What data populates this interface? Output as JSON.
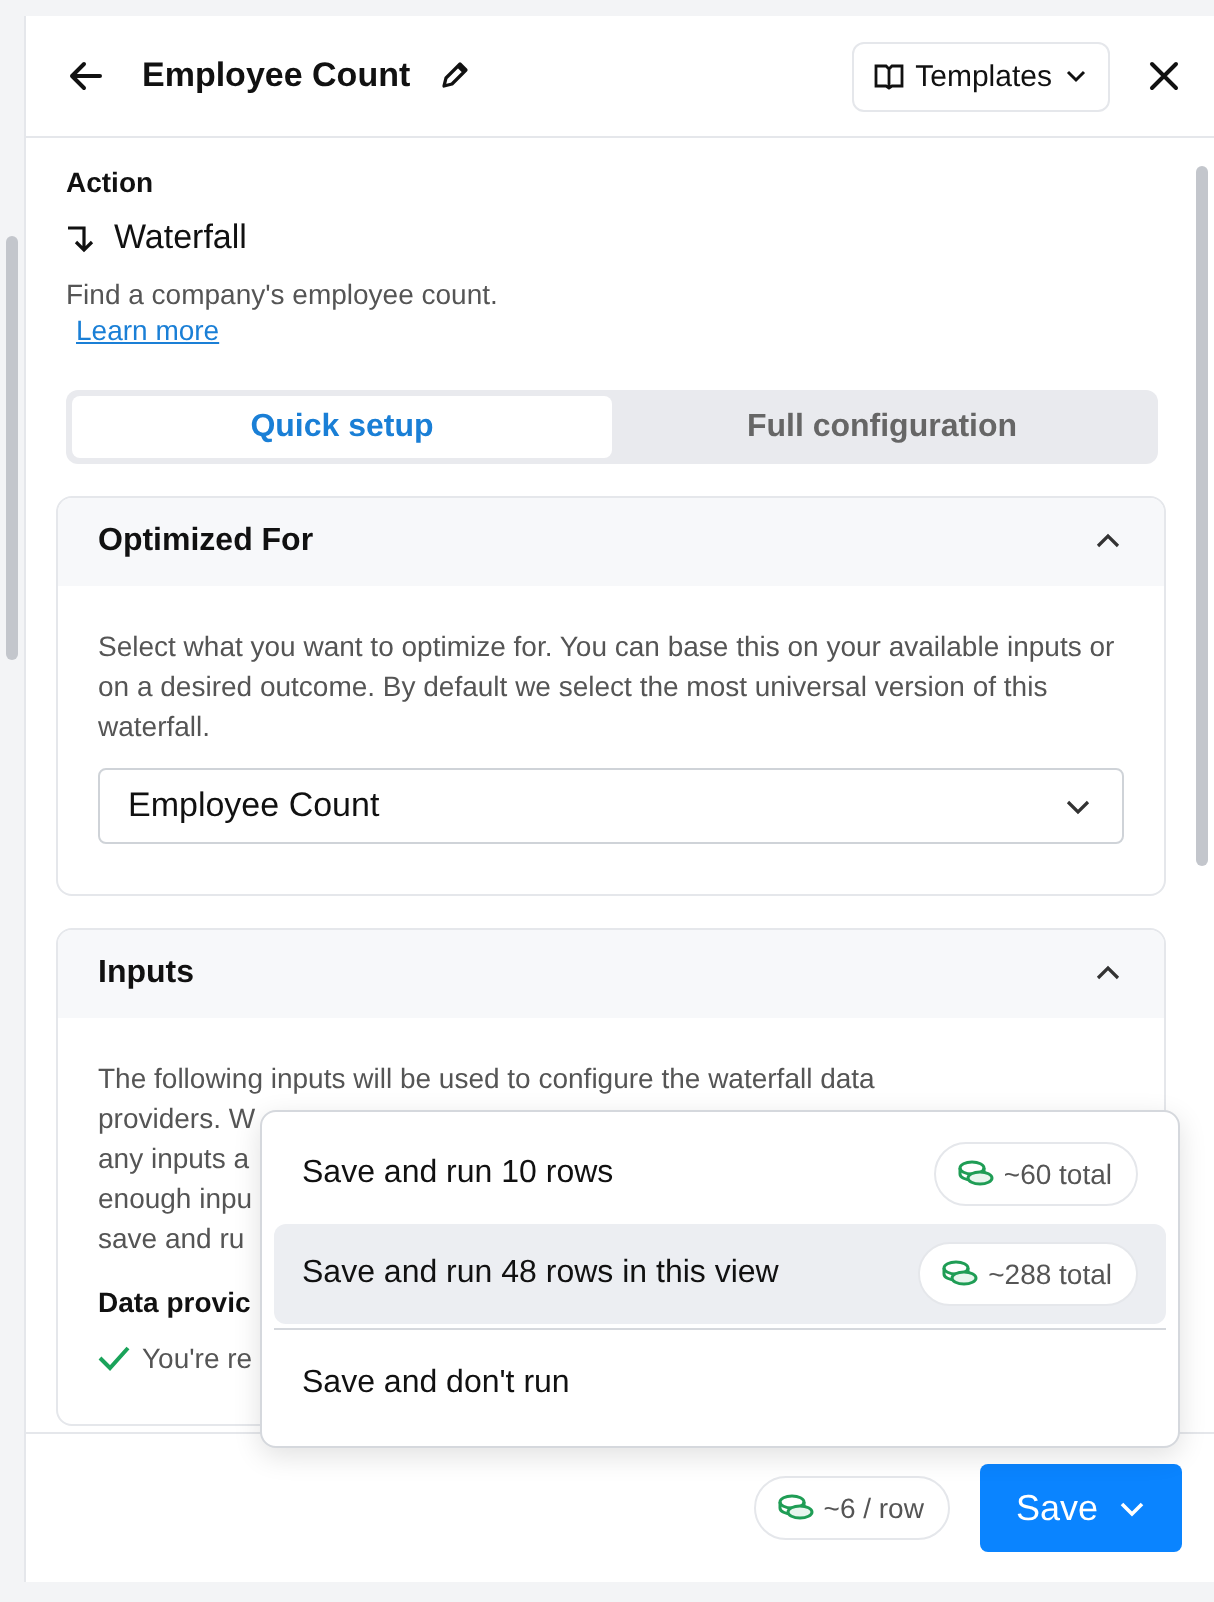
{
  "header": {
    "title": "Employee Count",
    "templates_button": "Templates"
  },
  "action": {
    "label": "Action",
    "name": "Waterfall",
    "description": "Find a company's employee count.",
    "link": "Learn more"
  },
  "tabs": [
    {
      "label": "Quick setup",
      "selected": true
    },
    {
      "label": "Full configuration",
      "selected": false
    }
  ],
  "sections": [
    {
      "title": "Optimized For",
      "expanded": true,
      "description": "Select what you want to optimize for. You can base this on your available inputs or on a desired outcome. By default we select the most universal version of this waterfall.",
      "select_value": "Employee Count"
    },
    {
      "title": "Inputs",
      "expanded": true,
      "lines": [
        "The following inputs will be used to configure the waterfall data",
        "providers. W",
        "any inputs a",
        "enough inpu",
        "save and ru"
      ],
      "subheading": "Data provic",
      "check_text": "You're re"
    }
  ],
  "menu": [
    {
      "label": "Save and run 10 rows",
      "cost": "~60 total",
      "selected": false
    },
    {
      "label": "Save and run 48 rows in this view",
      "cost": "~288 total",
      "selected": true
    },
    {
      "label": "Save and don't run",
      "selected": false
    }
  ],
  "footer": {
    "cost": "~6 / row",
    "save_button": "Save"
  }
}
